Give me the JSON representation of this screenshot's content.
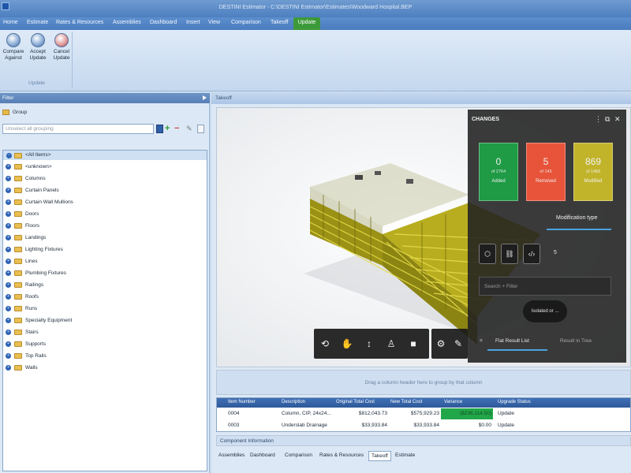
{
  "window": {
    "title": "DESTINI Estimator - C:\\DESTINI Estimator\\Estimates\\Woodward Hospital.BEP"
  },
  "menu": {
    "items": [
      "Home",
      "Estimate",
      "Rates & Resources",
      "Assemblies",
      "Dashboard",
      "Insert",
      "View",
      "Comparison",
      "Takeoff",
      "Update"
    ],
    "active": "Update"
  },
  "ribbon": {
    "buttons": [
      {
        "label": "Compare Against"
      },
      {
        "label": "Accept Update"
      },
      {
        "label": "Cancel Update"
      }
    ],
    "group_label": "Update"
  },
  "filter_panel": {
    "title": "Filter",
    "group_header": "Group",
    "grouping_placeholder": "Unselect all grouping",
    "tree": {
      "root": "<All Items>",
      "items": [
        "<unknown>",
        "Columns",
        "Curtain Panels",
        "Curtain Wall Mullions",
        "Doors",
        "Floors",
        "Landings",
        "Lighting Fixtures",
        "Lines",
        "Plumbing Fixtures",
        "Railings",
        "Roofs",
        "Runs",
        "Specialty Equipment",
        "Stairs",
        "Supports",
        "Top Rails",
        "Walls"
      ]
    }
  },
  "main": {
    "header": "Takeoff"
  },
  "changes_panel": {
    "title": "CHANGES",
    "stats": {
      "added": {
        "count": "0",
        "of": "of 2764",
        "label": "Added",
        "color": "#1f9b45"
      },
      "removed": {
        "count": "5",
        "of": "of 145",
        "label": "Removed",
        "color": "#e8543a"
      },
      "modified": {
        "count": "869",
        "of": "of 1468",
        "label": "Modified",
        "color": "#c2b42a"
      }
    },
    "modification_type": "Modification type",
    "type_count": "5",
    "filter_placeholder": "Search + Filter",
    "isolated_label": "Isolated or ...",
    "tabs": {
      "flat": "Flat Result List",
      "tree": "Result in Tree"
    }
  },
  "grid": {
    "group_hint": "Drag a column header here to group by that column",
    "headers": [
      "Item Number",
      "Description",
      "Original Total Cost",
      "New Total Cost",
      "Variance",
      "Upgrade Status"
    ],
    "rows": [
      {
        "item": "0004",
        "desc": "Column, CIP, 24x24...",
        "orig": "$812,043.73",
        "new": "$575,929.23",
        "variance": "($236,114.50)",
        "status": "Update"
      },
      {
        "item": "0003",
        "desc": "Underslab Drainage",
        "orig": "$33,933.84",
        "new": "$33,933.84",
        "variance": "$0.00",
        "status": "Update"
      }
    ]
  },
  "component_info": "Component Information",
  "bottom_tabs": [
    "Assemblies",
    "Dashboard",
    "Comparison",
    "Rates & Resources",
    "Takeoff",
    "Estimate"
  ],
  "active_bottom_tab": "Takeoff"
}
